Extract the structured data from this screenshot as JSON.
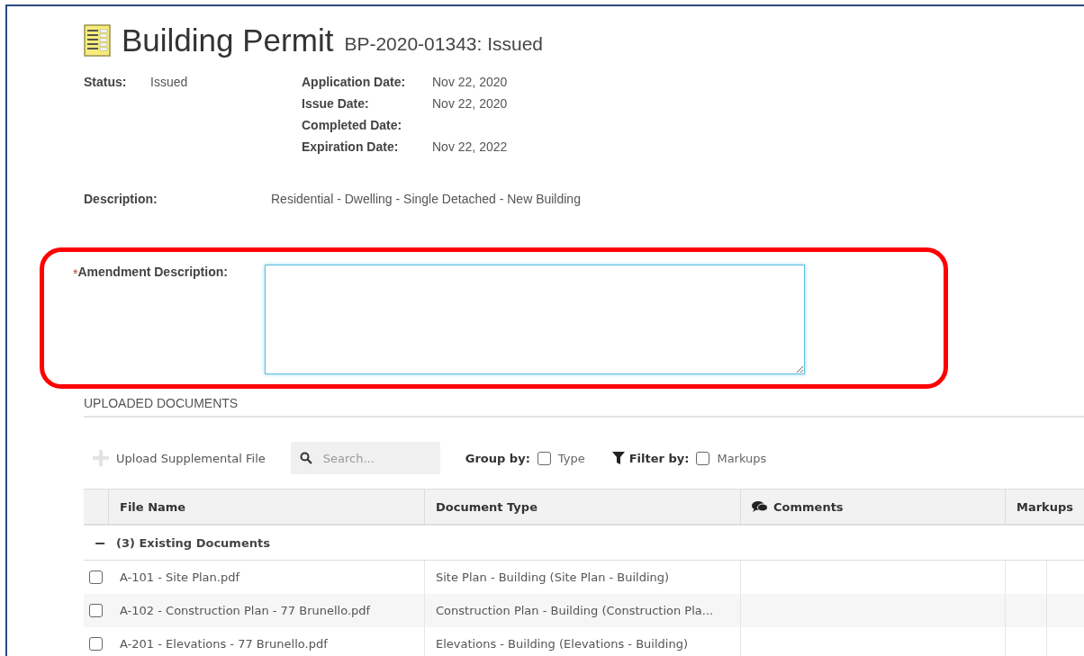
{
  "header": {
    "title": "Building Permit",
    "subtitle": "BP-2020-01343: Issued"
  },
  "status": {
    "label": "Status:",
    "value": "Issued"
  },
  "dates": [
    {
      "label": "Application Date:",
      "value": "Nov 22, 2020"
    },
    {
      "label": "Issue Date:",
      "value": "Nov 22, 2020"
    },
    {
      "label": "Completed Date:"
    },
    {
      "label": "Expiration Date:",
      "value": "Nov 22, 2022"
    }
  ],
  "description": {
    "label": "Description:",
    "value": "Residential - Dwelling - Single Detached - New Building"
  },
  "amendment": {
    "required_mark": "*",
    "label": "Amendment Description:"
  },
  "documents": {
    "heading": "UPLOADED DOCUMENTS",
    "toolbar": {
      "upload_label": "Upload Supplemental File",
      "search_placeholder": "Search...",
      "group_by_label": "Group by:",
      "group_by_option": {
        "label": "Type",
        "checked": false
      },
      "filter_by_label": "Filter by:",
      "filter_by_option": {
        "label": "Markups",
        "checked": false
      }
    },
    "columns": [
      "File Name",
      "Document Type",
      "Comments",
      "Markups"
    ],
    "groups": [
      {
        "toggle": "−",
        "label": "(3) Existing Documents",
        "rows": [
          {
            "checked": false,
            "file_name": "A-101 - Site Plan.pdf",
            "document_type": "Site Plan - Building (Site Plan - Building)"
          },
          {
            "checked": false,
            "file_name": "A-102 - Construction Plan - 77 Brunello.pdf",
            "document_type": "Construction Plan - Building (Construction Pla..."
          },
          {
            "checked": false,
            "file_name": "A-201 - Elevations - 77 Brunello.pdf",
            "document_type": "Elevations - Building (Elevations - Building)"
          }
        ]
      }
    ]
  }
}
